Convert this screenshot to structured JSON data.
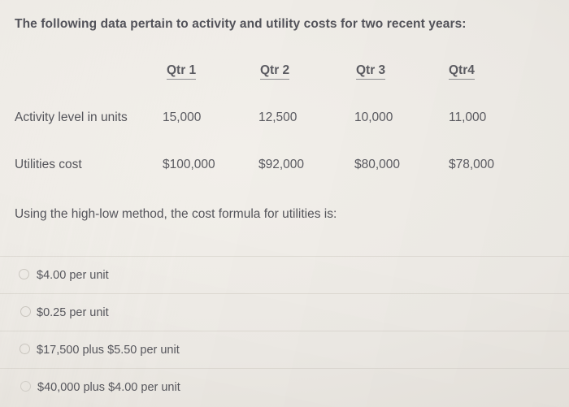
{
  "prompt": "The following data pertain to activity and utility costs for two recent years:",
  "table": {
    "headers": [
      "Qtr 1",
      "Qtr 2",
      "Qtr 3",
      "Qtr4"
    ],
    "rows": [
      {
        "label": "Activity level in units",
        "values": [
          "15,000",
          "12,500",
          "10,000",
          "11,000"
        ]
      },
      {
        "label": "Utilities cost",
        "values": [
          "$100,000",
          "$92,000",
          "$80,000",
          "$78,000"
        ]
      }
    ]
  },
  "question": "Using the high-low method, the cost formula for utilities is:",
  "options": [
    {
      "label": "$4.00 per unit",
      "selected": false
    },
    {
      "label": "$0.25 per unit",
      "selected": false
    },
    {
      "label": "$17,500 plus $5.50 per unit",
      "selected": false
    },
    {
      "label": "$40,000 plus $4.00 per unit",
      "selected": false
    }
  ],
  "colors": {
    "background": "#eeebe6",
    "text": "#55555b",
    "divider": "#dedad3",
    "radio_border": "#cbc7c0",
    "header_underline": "#8d8d90"
  }
}
